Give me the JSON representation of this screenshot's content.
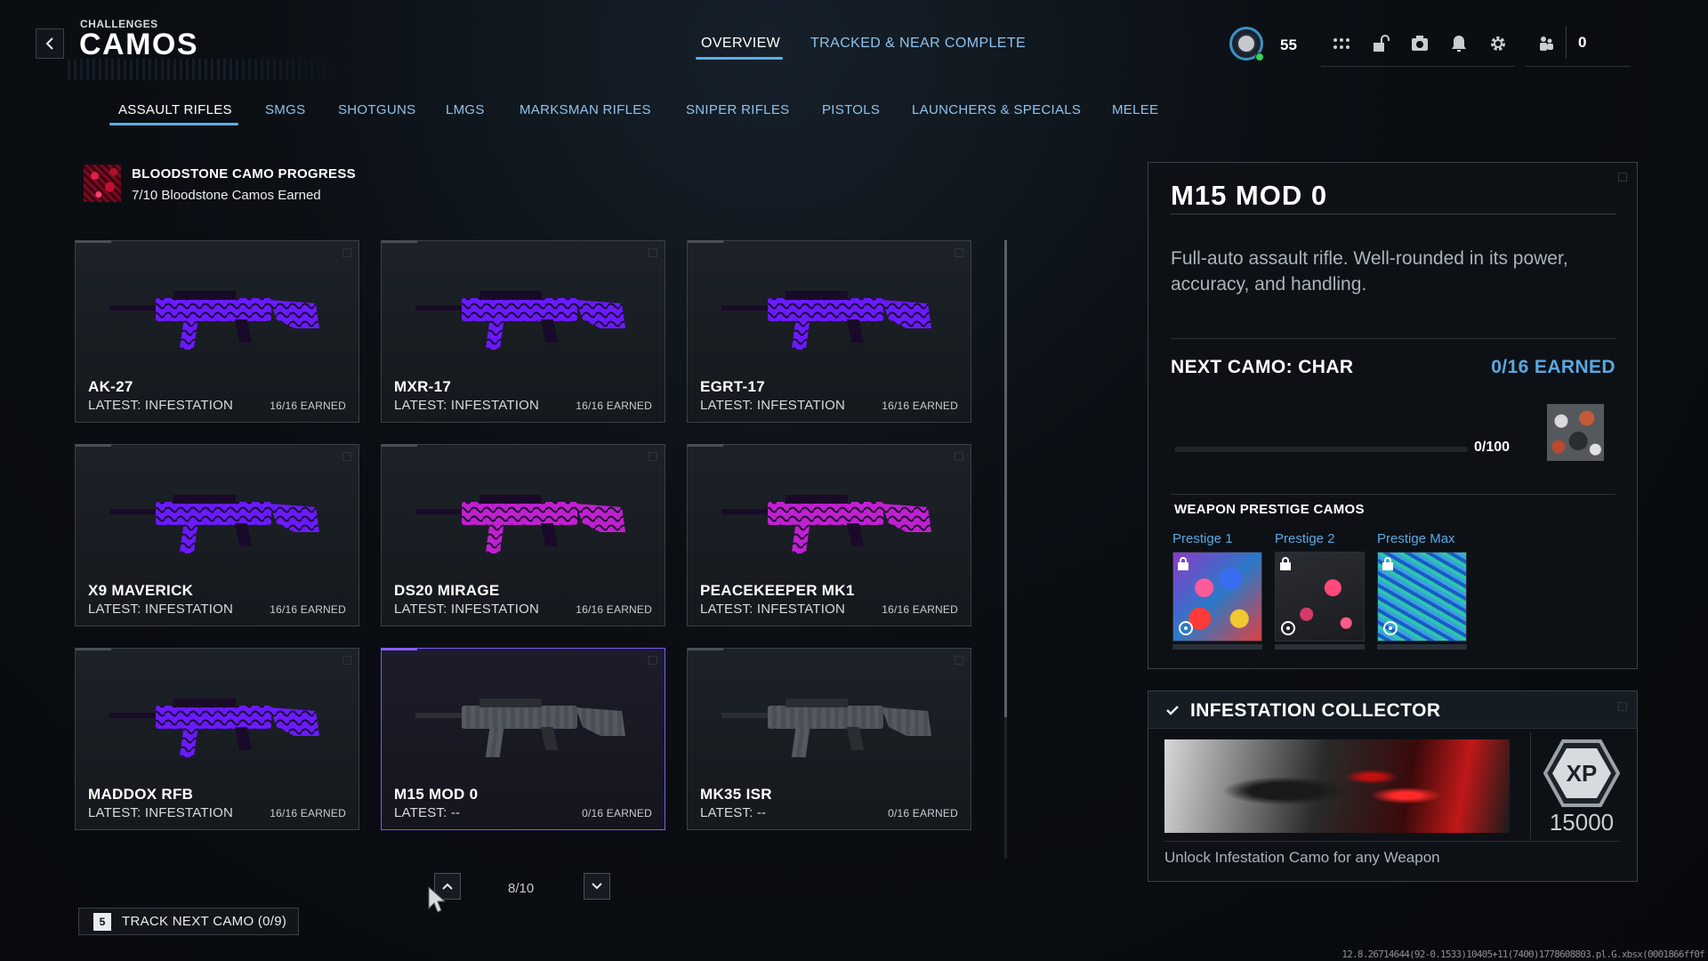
{
  "header": {
    "breadcrumb": "CHALLENGES",
    "title": "CAMOS",
    "tabs": [
      {
        "label": "OVERVIEW",
        "active": true
      },
      {
        "label": "TRACKED & NEAR COMPLETE",
        "active": false
      }
    ],
    "player_level": "55",
    "party_count": "0",
    "icons": [
      "apps-grid-icon",
      "unlock-icon",
      "screenshot-icon",
      "notification-bell-icon",
      "settings-gear-icon",
      "party-icon"
    ]
  },
  "categories": [
    {
      "label": "ASSAULT RIFLES",
      "active": true
    },
    {
      "label": "SMGS",
      "active": false
    },
    {
      "label": "SHOTGUNS",
      "active": false
    },
    {
      "label": "LMGS",
      "active": false
    },
    {
      "label": "MARKSMAN RIFLES",
      "active": false
    },
    {
      "label": "SNIPER RIFLES",
      "active": false
    },
    {
      "label": "PISTOLS",
      "active": false
    },
    {
      "label": "LAUNCHERS & SPECIALS",
      "active": false
    },
    {
      "label": "MELEE",
      "active": false
    }
  ],
  "bloodstone": {
    "title": "BLOODSTONE CAMO PROGRESS",
    "subtitle": "7/10 Bloodstone Camos Earned"
  },
  "weapons": [
    {
      "name": "AK-27",
      "latest": "LATEST: INFESTATION",
      "earned": "16/16 EARNED",
      "camo": "purple"
    },
    {
      "name": "MXR-17",
      "latest": "LATEST: INFESTATION",
      "earned": "16/16 EARNED",
      "camo": "purple"
    },
    {
      "name": "EGRT-17",
      "latest": "LATEST: INFESTATION",
      "earned": "16/16 EARNED",
      "camo": "purple"
    },
    {
      "name": "X9 MAVERICK",
      "latest": "LATEST: INFESTATION",
      "earned": "16/16 EARNED",
      "camo": "purple"
    },
    {
      "name": "DS20 MIRAGE",
      "latest": "LATEST: INFESTATION",
      "earned": "16/16 EARNED",
      "camo": "magenta"
    },
    {
      "name": "PEACEKEEPER MK1",
      "latest": "LATEST: INFESTATION",
      "earned": "16/16 EARNED",
      "camo": "magenta"
    },
    {
      "name": "MADDOX RFB",
      "latest": "LATEST: INFESTATION",
      "earned": "16/16 EARNED",
      "camo": "purple"
    },
    {
      "name": "M15 MOD 0",
      "latest": "LATEST: --",
      "earned": "0/16 EARNED",
      "camo": "none",
      "selected": true
    },
    {
      "name": "MK35 ISR",
      "latest": "LATEST: --",
      "earned": "0/16 EARNED",
      "camo": "none"
    }
  ],
  "pagination": {
    "text": "8/10"
  },
  "track": {
    "key": "5",
    "label": "TRACK NEXT CAMO (0/9)"
  },
  "build_info": "12.8.26714644(92-0.1533)10405+11(7400)1778608803.pl.G.xbsx(0001866ff0f",
  "detail": {
    "title": "M15 MOD 0",
    "description": "Full-auto assault rifle. Well-rounded in its power, accuracy, and handling.",
    "next_camo": "NEXT CAMO: CHAR",
    "earned": "0/16 EARNED",
    "progress_text": "0/100",
    "progress_fraction": 0,
    "prestige_title": "WEAPON PRESTIGE CAMOS",
    "prestige": [
      {
        "label": "Prestige 1",
        "locked": true
      },
      {
        "label": "Prestige 2",
        "locked": true
      },
      {
        "label": "Prestige Max",
        "locked": true
      }
    ]
  },
  "collector": {
    "title": "INFESTATION COLLECTOR",
    "xp_label": "XP",
    "xp": "15000",
    "description": "Unlock Infestation Camo for any Weapon"
  },
  "colors": {
    "accent_blue": "#5bb0e6",
    "earned_blue": "#5ba8e0",
    "selected_purple": "#7a5cff",
    "infestation_purple": "#6a1aff",
    "infestation_magenta": "#c020d0"
  }
}
